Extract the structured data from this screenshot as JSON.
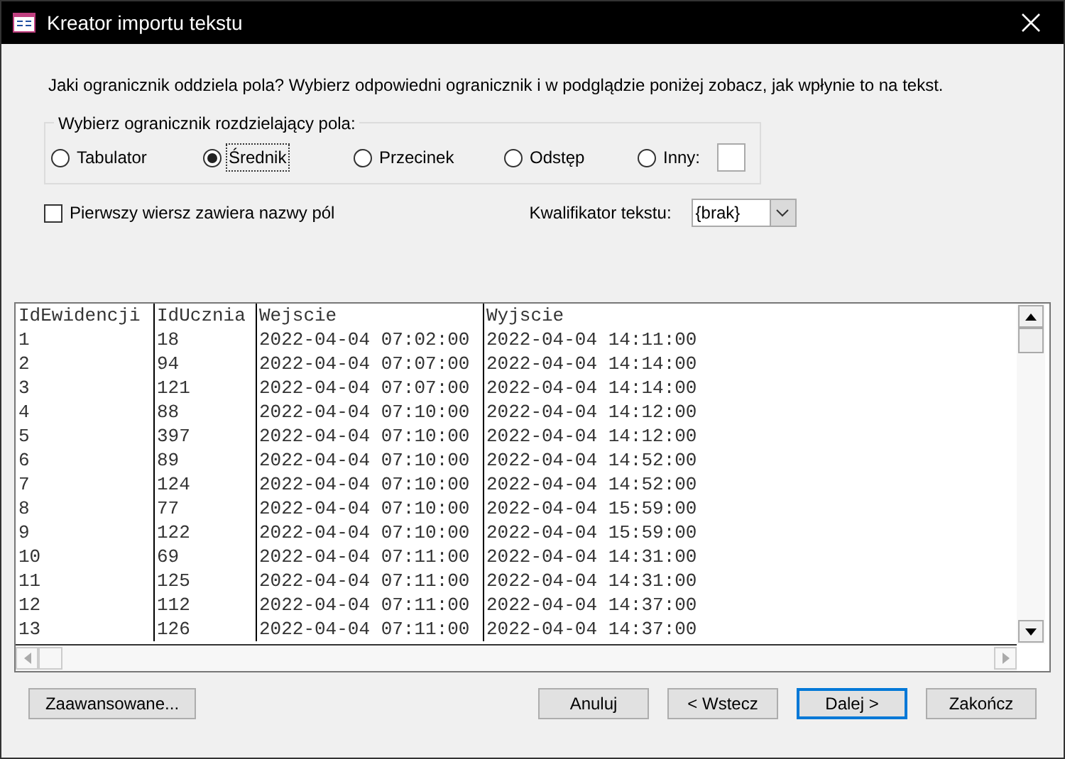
{
  "window": {
    "title": "Kreator importu tekstu"
  },
  "prompt": "Jaki ogranicznik oddziela pola? Wybierz odpowiedni ogranicznik i w podglądzie poniżej zobacz, jak wpłynie to na tekst.",
  "delimiter_group": {
    "label": "Wybierz ogranicznik rozdzielający pola:",
    "options": [
      {
        "label": "Tabulator",
        "selected": false
      },
      {
        "label": "Średnik",
        "selected": true
      },
      {
        "label": "Przecinek",
        "selected": false
      },
      {
        "label": "Odstęp",
        "selected": false
      },
      {
        "label": "Inny:",
        "selected": false
      }
    ]
  },
  "first_row_names": {
    "label": "Pierwszy wiersz zawiera nazwy pól",
    "checked": false
  },
  "text_qualifier": {
    "label": "Kwalifikator tekstu:",
    "value": "{brak}"
  },
  "preview": {
    "columns": [
      "IdEwidencji",
      "IdUcznia",
      "Wejscie",
      "Wyjscie"
    ],
    "rows": [
      [
        "1",
        "18",
        "2022-04-04 07:02:00",
        "2022-04-04 14:11:00"
      ],
      [
        "2",
        "94",
        "2022-04-04 07:07:00",
        "2022-04-04 14:14:00"
      ],
      [
        "3",
        "121",
        "2022-04-04 07:07:00",
        "2022-04-04 14:14:00"
      ],
      [
        "4",
        "88",
        "2022-04-04 07:10:00",
        "2022-04-04 14:12:00"
      ],
      [
        "5",
        "397",
        "2022-04-04 07:10:00",
        "2022-04-04 14:12:00"
      ],
      [
        "6",
        "89",
        "2022-04-04 07:10:00",
        "2022-04-04 14:52:00"
      ],
      [
        "7",
        "124",
        "2022-04-04 07:10:00",
        "2022-04-04 14:52:00"
      ],
      [
        "8",
        "77",
        "2022-04-04 07:10:00",
        "2022-04-04 15:59:00"
      ],
      [
        "9",
        "122",
        "2022-04-04 07:10:00",
        "2022-04-04 15:59:00"
      ],
      [
        "10",
        "69",
        "2022-04-04 07:11:00",
        "2022-04-04 14:31:00"
      ],
      [
        "11",
        "125",
        "2022-04-04 07:11:00",
        "2022-04-04 14:31:00"
      ],
      [
        "12",
        "112",
        "2022-04-04 07:11:00",
        "2022-04-04 14:37:00"
      ],
      [
        "13",
        "126",
        "2022-04-04 07:11:00",
        "2022-04-04 14:37:00"
      ]
    ]
  },
  "buttons": [
    {
      "label": "Zaawansowane...",
      "kind": "left",
      "default": false
    },
    {
      "label": "Anuluj",
      "kind": "right",
      "default": false
    },
    {
      "label": "< Wstecz",
      "kind": "right",
      "default": false
    },
    {
      "label": "Dalej >",
      "kind": "right",
      "default": true
    },
    {
      "label": "Zakończ",
      "kind": "right",
      "default": false
    }
  ]
}
